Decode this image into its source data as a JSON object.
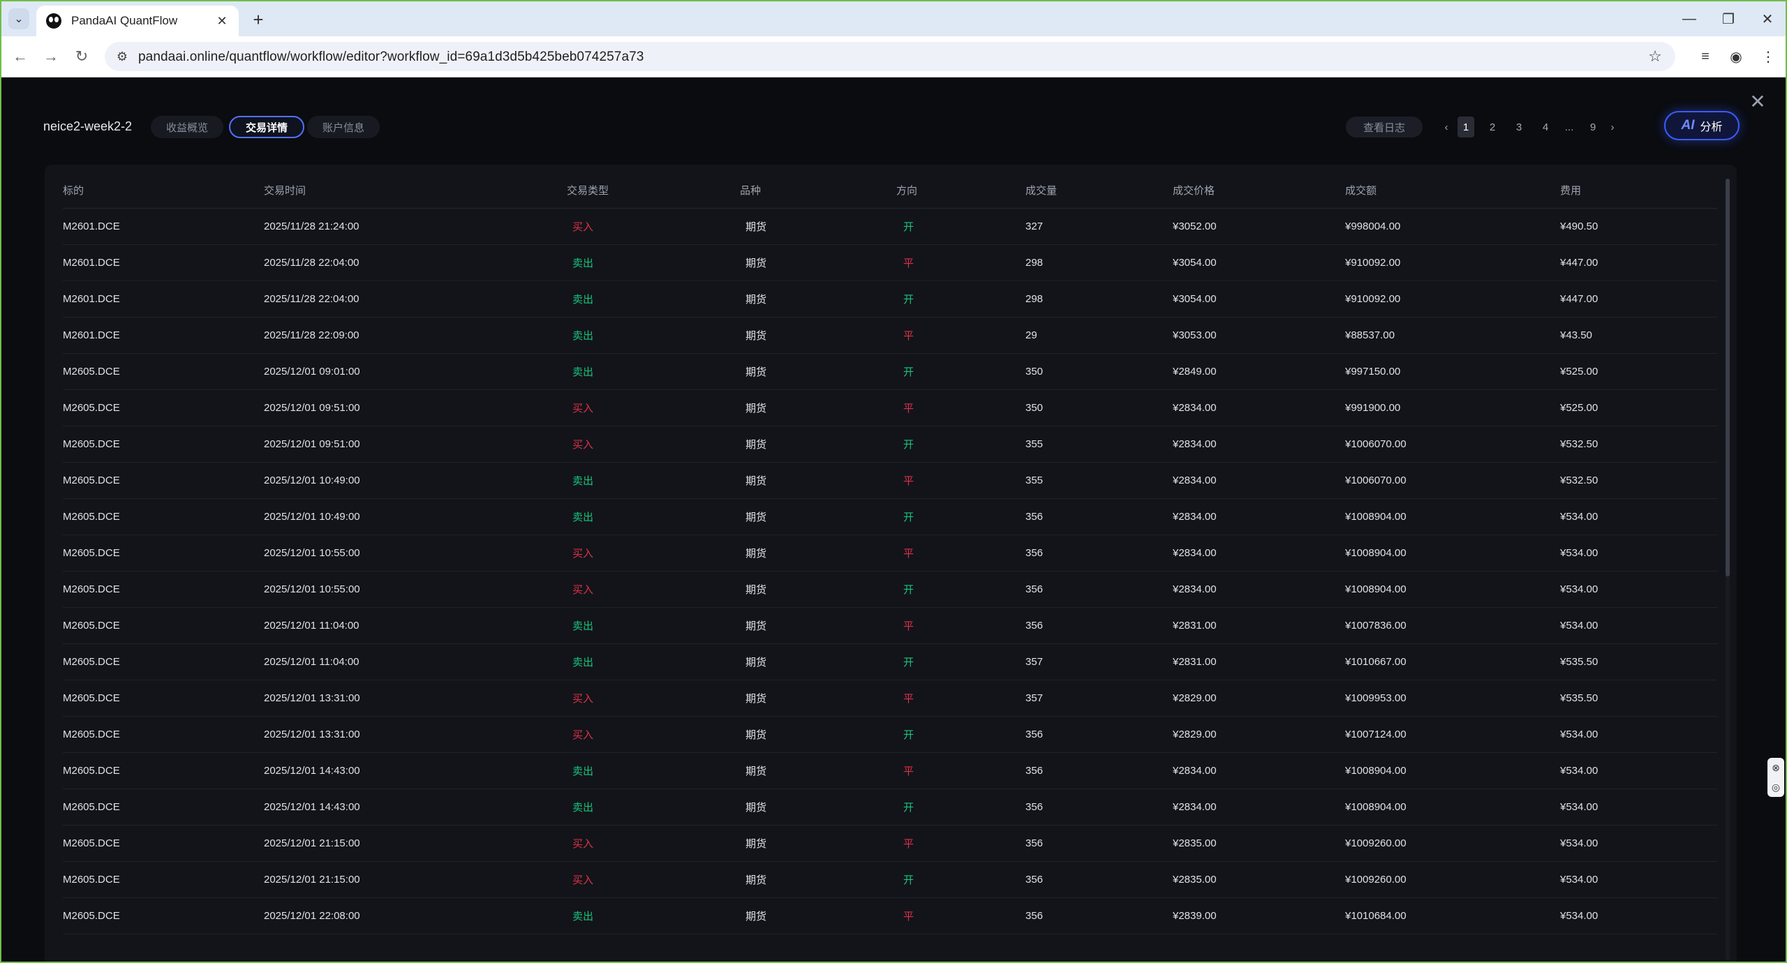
{
  "browser": {
    "tab_title": "PandaAI QuantFlow",
    "url": "pandaai.online/quantflow/workflow/editor?workflow_id=69a1d3d5b425beb074257a73"
  },
  "header": {
    "workflow_name": "neice2-week2-2",
    "tabs": [
      {
        "label": "收益概览",
        "active": false
      },
      {
        "label": "交易详情",
        "active": true
      },
      {
        "label": "账户信息",
        "active": false
      }
    ],
    "log_button": "查看日志",
    "pagination": {
      "prev": "‹",
      "pages": [
        "1",
        "2",
        "3",
        "4",
        "...",
        "9"
      ],
      "current": "1",
      "next": "›"
    },
    "ai_button": "分析",
    "ai_icon": "AI"
  },
  "table": {
    "columns": [
      "标的",
      "交易时间",
      "交易类型",
      "品种",
      "方向",
      "成交量",
      "成交价格",
      "成交额",
      "费用"
    ],
    "rows": [
      [
        "M2601.DCE",
        "2025/11/28 21:24:00",
        "买入",
        "期货",
        "开",
        "327",
        "¥3052.00",
        "¥998004.00",
        "¥490.50"
      ],
      [
        "M2601.DCE",
        "2025/11/28 22:04:00",
        "卖出",
        "期货",
        "平",
        "298",
        "¥3054.00",
        "¥910092.00",
        "¥447.00"
      ],
      [
        "M2601.DCE",
        "2025/11/28 22:04:00",
        "卖出",
        "期货",
        "开",
        "298",
        "¥3054.00",
        "¥910092.00",
        "¥447.00"
      ],
      [
        "M2601.DCE",
        "2025/11/28 22:09:00",
        "卖出",
        "期货",
        "平",
        "29",
        "¥3053.00",
        "¥88537.00",
        "¥43.50"
      ],
      [
        "M2605.DCE",
        "2025/12/01 09:01:00",
        "卖出",
        "期货",
        "开",
        "350",
        "¥2849.00",
        "¥997150.00",
        "¥525.00"
      ],
      [
        "M2605.DCE",
        "2025/12/01 09:51:00",
        "买入",
        "期货",
        "平",
        "350",
        "¥2834.00",
        "¥991900.00",
        "¥525.00"
      ],
      [
        "M2605.DCE",
        "2025/12/01 09:51:00",
        "买入",
        "期货",
        "开",
        "355",
        "¥2834.00",
        "¥1006070.00",
        "¥532.50"
      ],
      [
        "M2605.DCE",
        "2025/12/01 10:49:00",
        "卖出",
        "期货",
        "平",
        "355",
        "¥2834.00",
        "¥1006070.00",
        "¥532.50"
      ],
      [
        "M2605.DCE",
        "2025/12/01 10:49:00",
        "卖出",
        "期货",
        "开",
        "356",
        "¥2834.00",
        "¥1008904.00",
        "¥534.00"
      ],
      [
        "M2605.DCE",
        "2025/12/01 10:55:00",
        "买入",
        "期货",
        "平",
        "356",
        "¥2834.00",
        "¥1008904.00",
        "¥534.00"
      ],
      [
        "M2605.DCE",
        "2025/12/01 10:55:00",
        "买入",
        "期货",
        "开",
        "356",
        "¥2834.00",
        "¥1008904.00",
        "¥534.00"
      ],
      [
        "M2605.DCE",
        "2025/12/01 11:04:00",
        "卖出",
        "期货",
        "平",
        "356",
        "¥2831.00",
        "¥1007836.00",
        "¥534.00"
      ],
      [
        "M2605.DCE",
        "2025/12/01 11:04:00",
        "卖出",
        "期货",
        "开",
        "357",
        "¥2831.00",
        "¥1010667.00",
        "¥535.50"
      ],
      [
        "M2605.DCE",
        "2025/12/01 13:31:00",
        "买入",
        "期货",
        "平",
        "357",
        "¥2829.00",
        "¥1009953.00",
        "¥535.50"
      ],
      [
        "M2605.DCE",
        "2025/12/01 13:31:00",
        "买入",
        "期货",
        "开",
        "356",
        "¥2829.00",
        "¥1007124.00",
        "¥534.00"
      ],
      [
        "M2605.DCE",
        "2025/12/01 14:43:00",
        "卖出",
        "期货",
        "平",
        "356",
        "¥2834.00",
        "¥1008904.00",
        "¥534.00"
      ],
      [
        "M2605.DCE",
        "2025/12/01 14:43:00",
        "卖出",
        "期货",
        "开",
        "356",
        "¥2834.00",
        "¥1008904.00",
        "¥534.00"
      ],
      [
        "M2605.DCE",
        "2025/12/01 21:15:00",
        "买入",
        "期货",
        "平",
        "356",
        "¥2835.00",
        "¥1009260.00",
        "¥534.00"
      ],
      [
        "M2605.DCE",
        "2025/12/01 21:15:00",
        "买入",
        "期货",
        "开",
        "356",
        "¥2835.00",
        "¥1009260.00",
        "¥534.00"
      ],
      [
        "M2605.DCE",
        "2025/12/01 22:08:00",
        "卖出",
        "期货",
        "平",
        "356",
        "¥2839.00",
        "¥1010684.00",
        "¥534.00"
      ]
    ]
  },
  "colors": {
    "buy": "#e0304a",
    "sell": "#19c37d",
    "accent": "#5372ff"
  }
}
